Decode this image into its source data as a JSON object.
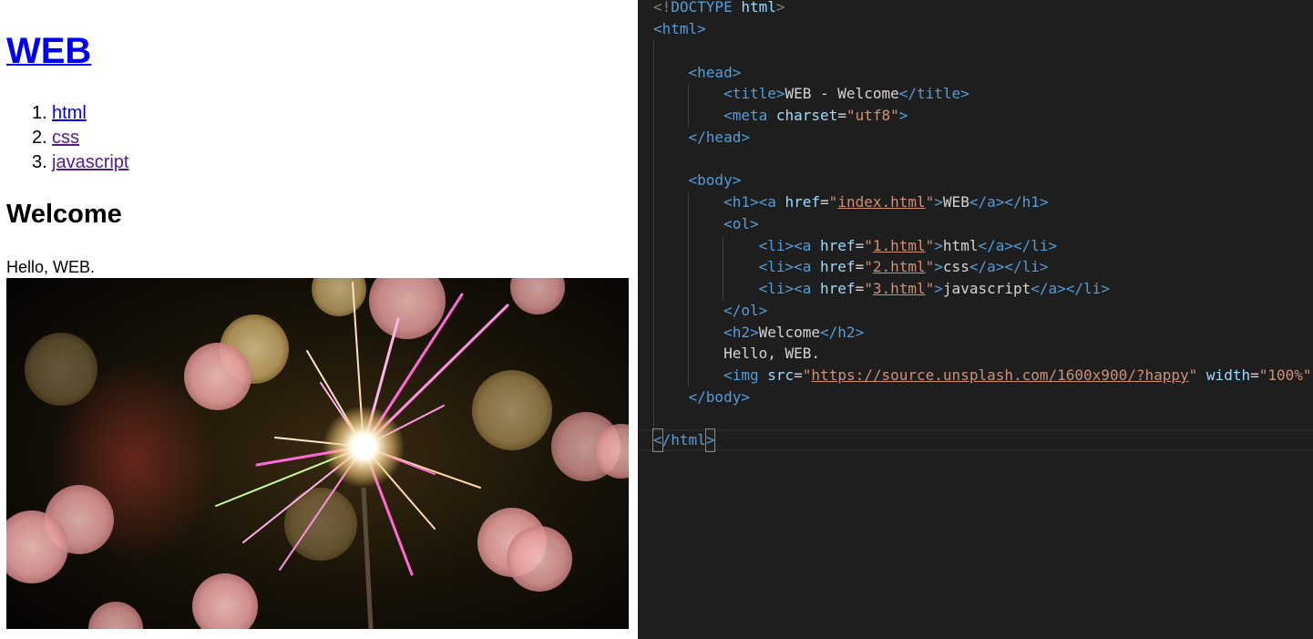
{
  "preview": {
    "h1_link": "WEB",
    "list": [
      {
        "num": "1.",
        "label": "html",
        "visited": false
      },
      {
        "num": "2.",
        "label": "css",
        "visited": true
      },
      {
        "num": "3.",
        "label": "javascript",
        "visited": true
      }
    ],
    "h2": "Welcome",
    "paragraph": "Hello, WEB.",
    "image_desc_icon": "sparkler-bokeh-photo"
  },
  "editor": {
    "l1_a": "<!",
    "l1_b": "DOCTYPE",
    "l1_c": "html",
    "l1_d": ">",
    "html_open": "<html>",
    "head_open": "<head>",
    "title_open": "<title>",
    "title_text": "WEB - Welcome",
    "title_close": "</title>",
    "meta_open": "<meta",
    "meta_attr": "charset",
    "eq": "=",
    "meta_val": "\"utf8\"",
    "gt": ">",
    "head_close": "</head>",
    "body_open": "<body>",
    "h1_open": "<h1><a",
    "href": "href",
    "quote": "\"",
    "h1_href": "index.html",
    "h1_text": "WEB",
    "h1_close": "</a></h1>",
    "ol_open": "<ol>",
    "li_open": "<li><a",
    "li1_href": "1.html",
    "li1_text": "html",
    "li2_href": "2.html",
    "li2_text": "css",
    "li3_href": "3.html",
    "li3_text": "javascript",
    "li_close": "</a></li>",
    "ol_close": "</ol>",
    "h2_open": "<h2>",
    "h2_text": "Welcome",
    "h2_close": "</h2>",
    "body_text": "Hello, WEB.",
    "img_open": "<img",
    "src": "src",
    "img_src": "https://source.unsplash.com/1600x900/?happy",
    "width_attr": "width",
    "width_val": "\"100%\"",
    "body_close": "</body>",
    "lt": "<",
    "slash_html": "/html",
    "html_close_gt": ">"
  },
  "colors": {
    "editor_bg": "#1e1e1e",
    "tag": "#569cd6",
    "attribute": "#9cdcfe",
    "string": "#ce9178",
    "link_unvisited": "#0000ee",
    "link_visited": "#551a8b"
  }
}
